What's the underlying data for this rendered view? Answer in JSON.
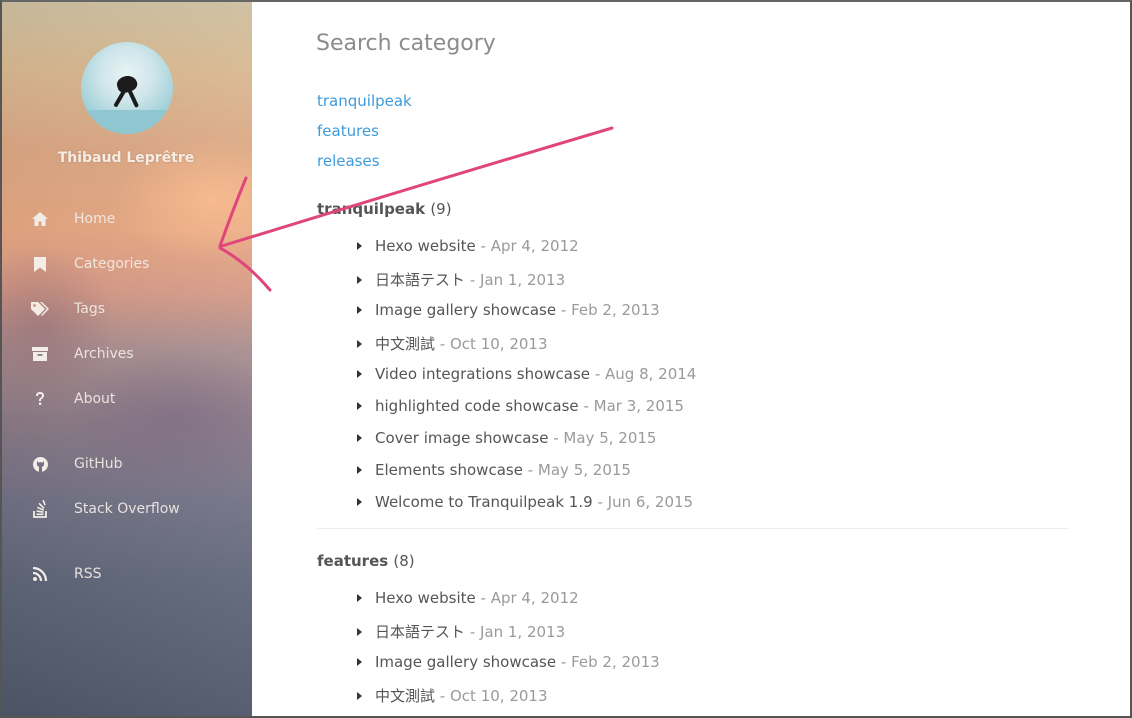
{
  "sidebar": {
    "author_name": "Thibaud Leprêtre",
    "nav": [
      {
        "label": "Home",
        "icon": "home-icon"
      },
      {
        "label": "Categories",
        "icon": "bookmark-icon"
      },
      {
        "label": "Tags",
        "icon": "tags-icon"
      },
      {
        "label": "Archives",
        "icon": "archive-icon"
      },
      {
        "label": "About",
        "icon": "question-icon"
      }
    ],
    "social": [
      {
        "label": "GitHub",
        "icon": "github-icon"
      },
      {
        "label": "Stack Overflow",
        "icon": "stack-overflow-icon"
      }
    ],
    "feed": {
      "label": "RSS",
      "icon": "rss-icon"
    }
  },
  "search": {
    "placeholder": "Search category",
    "value": ""
  },
  "category_links": [
    "tranquilpeak",
    "features",
    "releases"
  ],
  "sections": [
    {
      "name": "tranquilpeak",
      "count": "(9)",
      "posts": [
        {
          "title": "Hexo website",
          "date": "Apr 4, 2012"
        },
        {
          "title": "日本語テスト",
          "date": "Jan 1, 2013"
        },
        {
          "title": "Image gallery showcase",
          "date": "Feb 2, 2013"
        },
        {
          "title": "中文測試",
          "date": "Oct 10, 2013"
        },
        {
          "title": "Video integrations showcase",
          "date": "Aug 8, 2014"
        },
        {
          "title": "highlighted code showcase",
          "date": "Mar 3, 2015"
        },
        {
          "title": "Cover image showcase",
          "date": "May 5, 2015"
        },
        {
          "title": "Elements showcase",
          "date": "May 5, 2015"
        },
        {
          "title": "Welcome to Tranquilpeak 1.9",
          "date": "Jun 6, 2015"
        }
      ]
    },
    {
      "name": "features",
      "count": "(8)",
      "posts": [
        {
          "title": "Hexo website",
          "date": "Apr 4, 2012"
        },
        {
          "title": "日本語テスト",
          "date": "Jan 1, 2013"
        },
        {
          "title": "Image gallery showcase",
          "date": "Feb 2, 2013"
        },
        {
          "title": "中文測試",
          "date": "Oct 10, 2013"
        }
      ]
    }
  ],
  "colors": {
    "link": "#3e9bdc",
    "annotation_arrow": "#e0457b",
    "date": "#9a9a9a"
  },
  "separator": "-"
}
